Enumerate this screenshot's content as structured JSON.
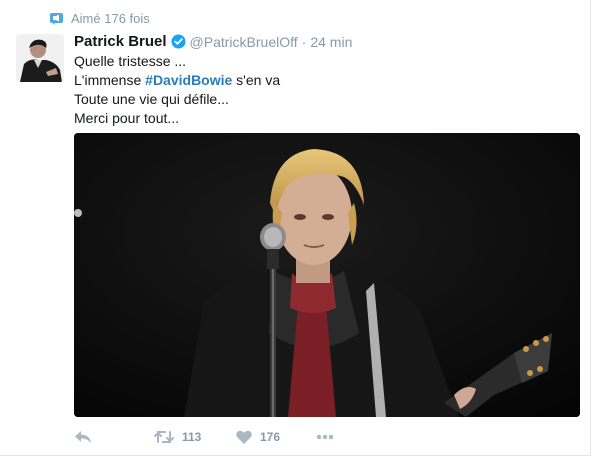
{
  "context": {
    "text": "Aimé 176 fois",
    "icon": "megaphone-icon",
    "color": "#8899a6"
  },
  "author": {
    "name": "Patrick Bruel",
    "handle": "@PatrickBruelOff",
    "separator": "·",
    "time": "24 min",
    "verified": true
  },
  "tweet": {
    "line1": "Quelle tristesse ...",
    "line2_prefix": "L'immense ",
    "hashtag": "#DavidBowie",
    "line2_suffix": " s'en va",
    "line3": "Toute une vie qui défile...",
    "line4": "Merci pour tout..."
  },
  "actions": {
    "reply_icon": "reply-icon",
    "retweet_count": "113",
    "like_count": "176",
    "more_icon": "more-icon"
  },
  "colors": {
    "accent": "#2b7bb9",
    "muted": "#8899a6",
    "verified": "#1da1f2"
  }
}
